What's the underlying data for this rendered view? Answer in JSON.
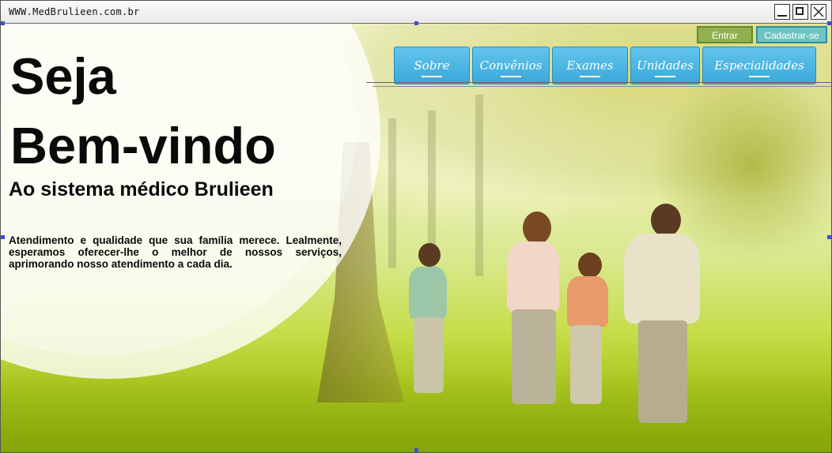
{
  "window": {
    "title": "WWW.MedBrulieen.com.br"
  },
  "auth": {
    "login_label": "Entrar",
    "signup_label": "Cadastrar-se"
  },
  "nav": {
    "items": [
      {
        "label": "Sobre"
      },
      {
        "label": "Convênios"
      },
      {
        "label": "Exames"
      },
      {
        "label": "Unidades"
      },
      {
        "label": "Especialidades"
      }
    ]
  },
  "hero": {
    "title_line1": "Seja",
    "title_line2": "Bem-vindo",
    "subtitle": "Ao sistema médico Brulieen",
    "description": "Atendimento e qualidade que sua família merece. Lealmente, esperamos oferecer-lhe o melhor de nossos serviços, aprimorando nosso atendimento a cada dia."
  },
  "colors": {
    "nav_bg": "#3aa8da",
    "login_bg": "#78a03c",
    "signup_bg": "#5abec8"
  }
}
